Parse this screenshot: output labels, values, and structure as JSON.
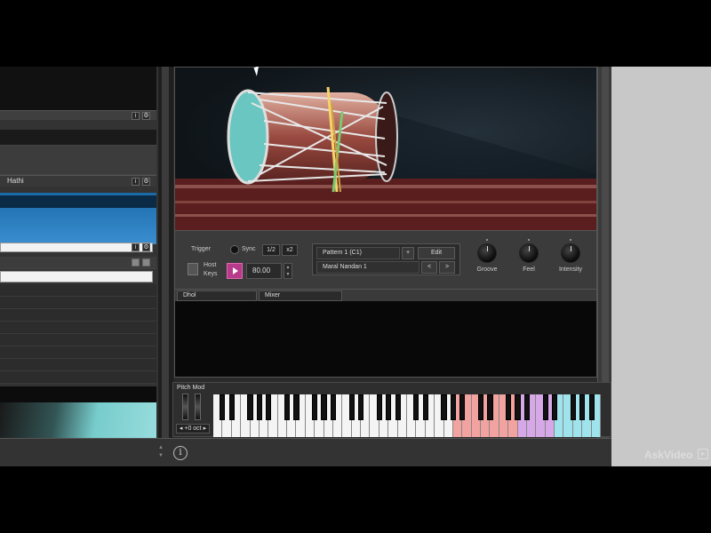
{
  "left_rack": {
    "slot3_title": "Hathi",
    "slot_info_label": "i",
    "slot_gear_label": "⚙"
  },
  "instrument": {
    "trigger_label": "Trigger",
    "sync_label": "Sync",
    "half_label": "1/2",
    "x2_label": "x2",
    "host_label": "Host",
    "keys_label": "Keys",
    "tempo_value": "80.00",
    "pattern_name": "Pattern 1 (C1)",
    "add_label": "+",
    "edit_label": "Edit",
    "preset_name": "Maral Nandan 1",
    "prev_label": "<",
    "next_label": ">",
    "knobs": [
      {
        "label": "Groove"
      },
      {
        "label": "Feel"
      },
      {
        "label": "Intensity"
      }
    ],
    "tabs": [
      "Dhol",
      "Mixer"
    ]
  },
  "keyboard": {
    "pitch_mod_label": "Pitch Mod",
    "octave_label": "◂ +0 oct ▸",
    "zones": {
      "normal": "#f4f4f4",
      "red": "#f2a3a0",
      "purple": "#d6a8e8",
      "cyan": "#9fe4ec"
    }
  },
  "bottom_bar": {
    "info_icon_label": "i"
  },
  "watermark": {
    "text": "AskVideo",
    "badge": "▸"
  }
}
